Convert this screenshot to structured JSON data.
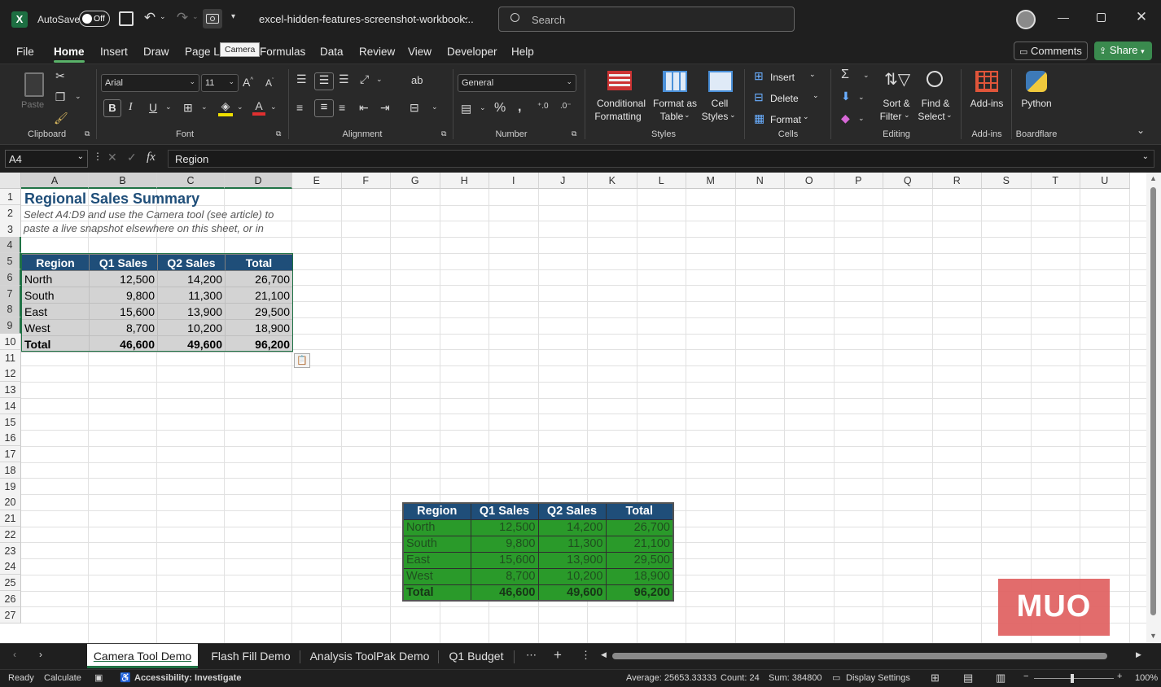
{
  "titlebar": {
    "autosave_label": "AutoSave",
    "autosave_state": "Off",
    "filename": "excel-hidden-features-screenshot-workbook...",
    "search_placeholder": "Search",
    "tooltip": "Camera"
  },
  "menu": [
    "File",
    "Home",
    "Insert",
    "Draw",
    "Page La",
    "Formulas",
    "Data",
    "Review",
    "View",
    "Developer",
    "Help"
  ],
  "menu_right": {
    "comments": "Comments",
    "share": "Share"
  },
  "ribbon": {
    "clipboard": {
      "paste": "Paste",
      "label": "Clipboard"
    },
    "font": {
      "name": "Arial",
      "size": "11",
      "label": "Font"
    },
    "alignment": {
      "label": "Alignment"
    },
    "number": {
      "format": "General",
      "label": "Number"
    },
    "styles": {
      "conditional": "Conditional",
      "conditional2": "Formatting",
      "format_as": "Format as",
      "format_as2": "Table",
      "cell": "Cell",
      "cell2": "Styles",
      "label": "Styles"
    },
    "cells": {
      "insert": "Insert",
      "delete": "Delete",
      "format": "Format",
      "label": "Cells"
    },
    "editing": {
      "sort": "Sort &",
      "sort2": "Filter",
      "find": "Find &",
      "find2": "Select",
      "label": "Editing"
    },
    "addins": {
      "btn": "Add-ins",
      "label": "Add-ins"
    },
    "python": {
      "btn": "Python",
      "label": "Boardflare"
    }
  },
  "formula_bar": {
    "name_box": "A4",
    "content": "Region"
  },
  "columns": [
    "A",
    "B",
    "C",
    "D",
    "E",
    "F",
    "G",
    "H",
    "I",
    "J",
    "K",
    "L",
    "M",
    "N",
    "O",
    "P",
    "Q",
    "R",
    "S",
    "T",
    "U"
  ],
  "rows": [
    "1",
    "2",
    "3",
    "4",
    "5",
    "6",
    "7",
    "8",
    "9",
    "10",
    "11",
    "12",
    "13",
    "14",
    "15",
    "16",
    "17",
    "18",
    "19",
    "20",
    "21",
    "22",
    "23",
    "24",
    "25",
    "26",
    "27"
  ],
  "sheet": {
    "title": "Regional Sales Summary",
    "note1": "Select A4:D9 and use the Camera tool (see article) to",
    "note2": "paste a live snapshot elsewhere on this sheet, or in",
    "headers": [
      "Region",
      "Q1 Sales",
      "Q2 Sales",
      "Total"
    ],
    "data": [
      [
        "North",
        "12,500",
        "14,200",
        "26,700"
      ],
      [
        "South",
        "9,800",
        "11,300",
        "21,100"
      ],
      [
        "East",
        "15,600",
        "13,900",
        "29,500"
      ],
      [
        "West",
        "8,700",
        "10,200",
        "18,900"
      ],
      [
        "Total",
        "46,600",
        "49,600",
        "96,200"
      ]
    ]
  },
  "tabs": [
    "Camera Tool Demo",
    "Flash Fill Demo",
    "Analysis ToolPak Demo",
    "Q1 Budget"
  ],
  "status": {
    "ready": "Ready",
    "calculate": "Calculate",
    "accessibility": "Accessibility: Investigate",
    "average": "Average: 25653.33333",
    "count": "Count: 24",
    "sum": "Sum: 384800",
    "display": "Display Settings",
    "zoom": "100%"
  },
  "watermark": "MUO",
  "colors": {
    "accent": "#207245",
    "header_blue": "#1f4e79",
    "snapshot_green": "#2a9a2a",
    "title_blue": "#1f4e79"
  }
}
